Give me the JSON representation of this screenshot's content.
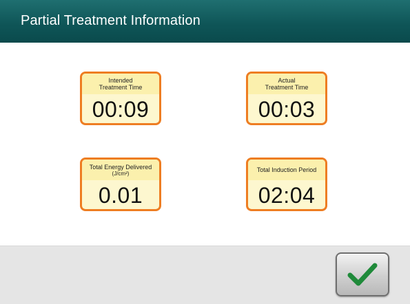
{
  "header": {
    "title": "Partial Treatment Information",
    "color": "#0f5658"
  },
  "cards": {
    "intended_time": {
      "label_line1": "Intended",
      "label_line2": "Treatment Time",
      "value": "00:09"
    },
    "actual_time": {
      "label_line1": "Actual",
      "label_line2": "Treatment Time",
      "value": "00:03"
    },
    "total_energy": {
      "label_line1": "Total Energy Delivered",
      "label_line2": "(J/cm²)",
      "value": "0.01"
    },
    "induction_period": {
      "label": "Total Induction Period",
      "value": "02:04"
    }
  },
  "colors": {
    "card_border": "#ee7d22",
    "card_background": "#fdf7cf",
    "checkmark": "#1f8a3a"
  },
  "footer": {
    "confirm_icon": "checkmark-icon"
  }
}
